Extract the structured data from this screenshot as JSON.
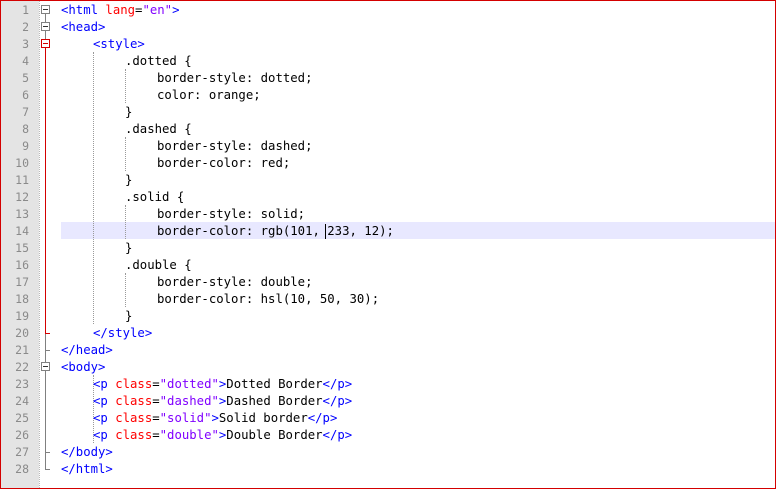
{
  "editor": {
    "line_numbers": [
      "1",
      "2",
      "3",
      "4",
      "5",
      "6",
      "7",
      "8",
      "9",
      "10",
      "11",
      "12",
      "13",
      "14",
      "15",
      "16",
      "17",
      "18",
      "19",
      "20",
      "21",
      "22",
      "23",
      "24",
      "25",
      "26",
      "27",
      "28"
    ],
    "current_line": "14",
    "code": {
      "l1_open": "<html ",
      "l1_attr": "lang",
      "l1_eq": "=",
      "l1_val": "\"en\"",
      "l1_close": ">",
      "l2": "<head>",
      "l3": "<style>",
      "l4": ".dotted {",
      "l5": "border-style: dotted;",
      "l6": "color: orange;",
      "l7": "}",
      "l8": ".dashed {",
      "l9": "border-style: dashed;",
      "l10": "border-color: red;",
      "l11": "}",
      "l12": ".solid {",
      "l13": "border-style: solid;",
      "l14": "border-color: rgb(101, 233, 12);",
      "l15": "}",
      "l16": ".double {",
      "l17": "border-style: double;",
      "l18": "border-color: hsl(10, 50, 30);",
      "l19": "}",
      "l20": "</style>",
      "l21": "</head>",
      "l22": "<body>",
      "l23_open": "<p ",
      "l23_attr": "class",
      "l23_eq": "=",
      "l23_val": "\"dotted\"",
      "l23_gt": ">",
      "l23_text": "Dotted Border",
      "l23_close": "</p>",
      "l24_open": "<p ",
      "l24_attr": "class",
      "l24_eq": "=",
      "l24_val": "\"dashed\"",
      "l24_gt": ">",
      "l24_text": "Dashed Border",
      "l24_close": "</p>",
      "l25_open": "<p ",
      "l25_attr": "class",
      "l25_eq": "=",
      "l25_val": "\"solid\"",
      "l25_gt": ">",
      "l25_text": "Solid border",
      "l25_close": "</p>",
      "l26_open": "<p ",
      "l26_attr": "class",
      "l26_eq": "=",
      "l26_val": "\"double\"",
      "l26_gt": ">",
      "l26_text": "Double Border",
      "l26_close": "</p>",
      "l27": "</body>",
      "l28": "</html>"
    }
  },
  "colors": {
    "tag": "#0000ff",
    "attribute": "#ff0000",
    "attribute_value": "#8000ff",
    "current_line_bg": "#e8e8ff",
    "frame_border": "#d40000"
  }
}
